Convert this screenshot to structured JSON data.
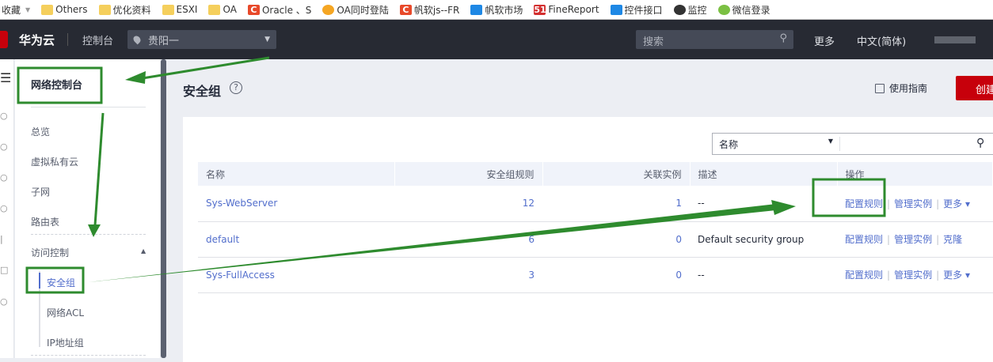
{
  "bookmarks": [
    {
      "label": "收藏",
      "icon": "dropdown"
    },
    {
      "label": "Others",
      "icon": "folder-icon"
    },
    {
      "label": "优化资料",
      "icon": "folder-icon"
    },
    {
      "label": "ESXI",
      "icon": "folder-icon"
    },
    {
      "label": "OA",
      "icon": "folder-icon"
    },
    {
      "label": "Oracle 、S",
      "icon": "c-icon"
    },
    {
      "label": "OA同时登陆",
      "icon": "oa-icon"
    },
    {
      "label": "帆软js--FR",
      "icon": "c-icon"
    },
    {
      "label": "帆软市场",
      "icon": "f-icon"
    },
    {
      "label": "FineReport",
      "icon": "51-icon"
    },
    {
      "label": "控件接口",
      "icon": "f-icon"
    },
    {
      "label": "监控",
      "icon": "camera-icon"
    },
    {
      "label": "微信登录",
      "icon": "wechat-icon"
    }
  ],
  "topnav": {
    "brand": "华为云",
    "console": "控制台",
    "region": "贵阳一",
    "search_placeholder": "搜索",
    "more": "更多",
    "language": "中文(简体)"
  },
  "sidebar": {
    "title": "网络控制台",
    "items": [
      "总览",
      "虚拟私有云",
      "子网",
      "路由表"
    ],
    "group": "访问控制",
    "subitems": [
      "安全组",
      "网络ACL",
      "IP地址组"
    ]
  },
  "page": {
    "title": "安全组",
    "guide": "使用指南",
    "create": "创建"
  },
  "filter": {
    "field": "名称"
  },
  "table": {
    "headers": [
      "名称",
      "安全组规则",
      "关联实例",
      "描述",
      "操作"
    ],
    "rows": [
      {
        "name": "Sys-WebServer",
        "rules": "12",
        "instances": "1",
        "desc": "--",
        "ops": [
          "配置规则",
          "管理实例",
          "更多 ▾"
        ]
      },
      {
        "name": "default",
        "rules": "6",
        "instances": "0",
        "desc": "Default security group",
        "ops": [
          "配置规则",
          "管理实例",
          "克隆"
        ]
      },
      {
        "name": "Sys-FullAccess",
        "rules": "3",
        "instances": "0",
        "desc": "--",
        "ops": [
          "配置规则",
          "管理实例",
          "更多 ▾"
        ]
      }
    ]
  },
  "colors": {
    "accent": "#526ecc",
    "create": "#c7000b",
    "nav": "#272a33",
    "annotation": "#2e8b2e"
  }
}
